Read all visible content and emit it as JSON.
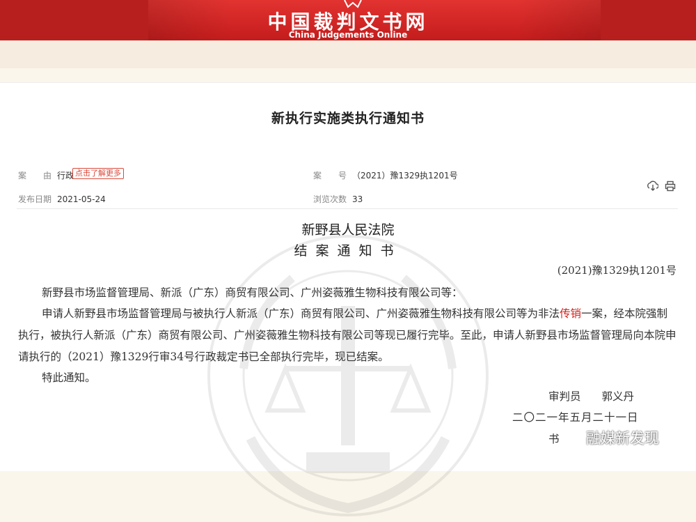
{
  "header": {
    "site_title_cn": "中国裁判文书网",
    "site_title_en": "China Judgements Online"
  },
  "document": {
    "title": "新执行实施类执行通知书",
    "meta": {
      "cause_label": "案　　由",
      "cause_value": "行政",
      "learn_more": "点击了解更多",
      "case_no_label": "案　　号",
      "case_no_value": "（2021）豫1329执1201号",
      "publish_date_label": "发布日期",
      "publish_date_value": "2021-05-24",
      "views_label": "浏览次数",
      "views_value": "33"
    },
    "body": {
      "court_name": "新野县人民法院",
      "notice_title": "结案通知书",
      "case_ref": "(2021)豫1329执1201号",
      "parties": "新野县市场监督管理局、新派（广东）商贸有限公司、广州姿薇雅生物科技有限公司等：",
      "para_before": "申请人新野县市场监督管理局与被执行人新派（广东）商贸有限公司、广州姿薇雅生物科技有限公司等为非法",
      "para_highlight": "传销",
      "para_after": "一案，经本院强制执行，被执行人新派（广东）商贸有限公司、广州姿薇雅生物科技有限公司等现已履行完毕。至此，申请人新野县市场监督管理局向本院申请执行的（2021）豫1329行审34号行政裁定书已全部执行完毕，现已结案。",
      "closing": "特此通知。",
      "judge_label": "审判员",
      "judge_name": "郭义丹",
      "date": "二〇二一年五月二十一日",
      "clerk_label": "书"
    },
    "watermark_text": "融媒新发现"
  },
  "colors": {
    "banner_red": "#c41c1c",
    "highlight_red": "#d1211b",
    "background": "#fbf6ec"
  }
}
